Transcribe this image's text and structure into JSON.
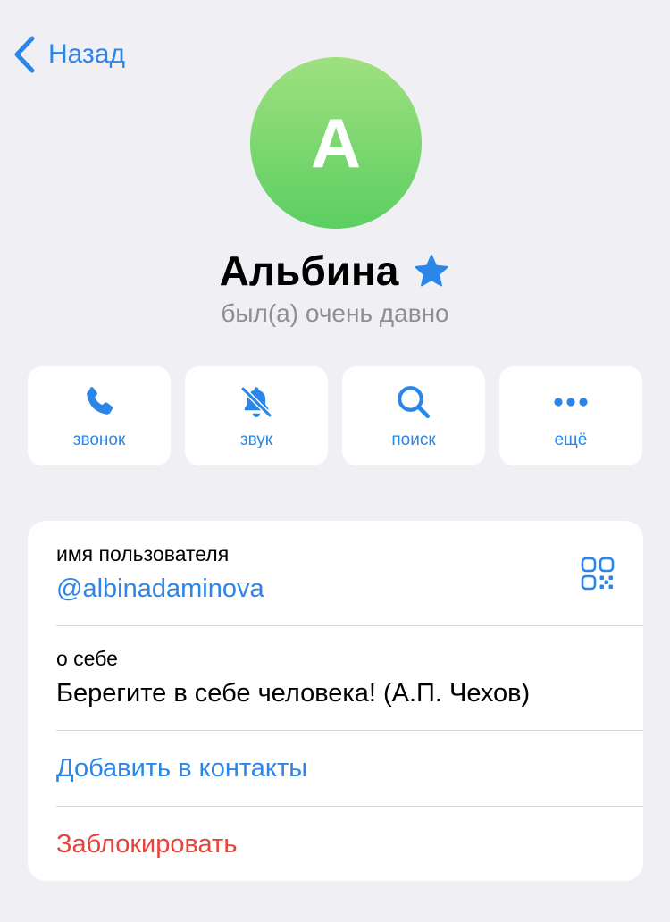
{
  "nav": {
    "back_label": "Назад"
  },
  "profile": {
    "avatar_letter": "А",
    "name": "Альбина",
    "status": "был(а) очень давно"
  },
  "actions": [
    {
      "label": "звонок",
      "icon": "phone-icon"
    },
    {
      "label": "звук",
      "icon": "bell-slash-icon"
    },
    {
      "label": "поиск",
      "icon": "search-icon"
    },
    {
      "label": "ещё",
      "icon": "more-icon"
    }
  ],
  "info": {
    "username_label": "имя пользователя",
    "username_value": "@albinadaminova",
    "bio_label": "о себе",
    "bio_value": "Берегите в себе человека! (А.П. Чехов)",
    "add_contact": "Добавить в контакты",
    "block": "Заблокировать"
  },
  "colors": {
    "accent": "#2b86e8",
    "danger": "#e8433a",
    "background": "#efeff4",
    "avatar_top": "#9fe07f",
    "avatar_bottom": "#5ccf62"
  }
}
